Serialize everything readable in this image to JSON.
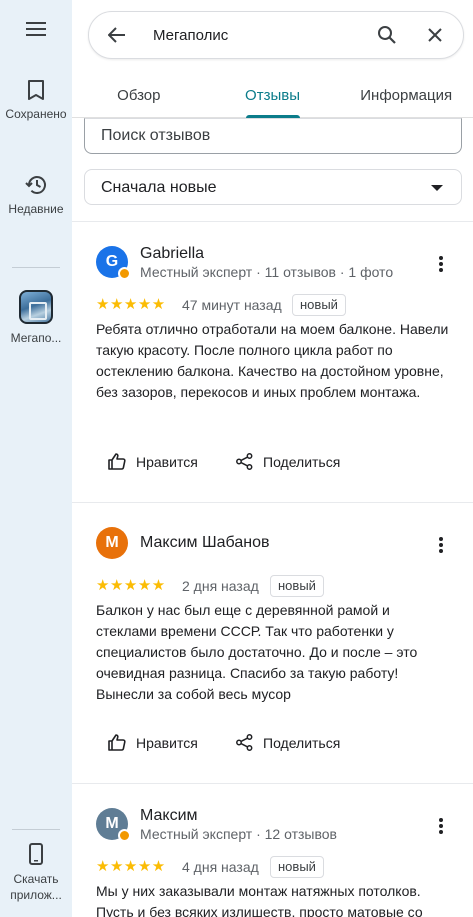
{
  "rail": {
    "menu_icon": "menu-icon",
    "saved_label": "Сохранено",
    "recent_label": "Недавние",
    "place_label": "Мегапо...",
    "download_label": "Скачать прилож..."
  },
  "search": {
    "value": "Мегаполис"
  },
  "tabs": [
    {
      "label": "Обзор",
      "active": false
    },
    {
      "label": "Отзывы",
      "active": true
    },
    {
      "label": "Информация",
      "active": false
    }
  ],
  "filters": {
    "search_placeholder": "Поиск отзывов",
    "sort_value": "Сначала новые"
  },
  "reviews": [
    {
      "initial": "G",
      "avatar_color": "#1a73e8",
      "author": "Gabriella",
      "meta": "Местный эксперт · 11 отзывов · 1 фото",
      "stars": "★★★★★",
      "date": "47 минут назад",
      "badge": "новый",
      "text": "Ребята отлично отработали на моем балконе. Навели такую красоту. После полного цикла работ по остеклению балкона. Качество на достойном уровне, без зазоров, перекосов и иных проблем монтажа.",
      "like_label": "Нравится",
      "share_label": "Поделиться"
    },
    {
      "initial": "М",
      "avatar_color": "#e8710a",
      "author": "Максим Шабанов",
      "meta": "",
      "stars": "★★★★★",
      "date": "2 дня назад",
      "badge": "новый",
      "text": "Балкон у нас был еще с деревянной рамой и стеклами времени СССР. Так что работенки у специалистов было достаточно. До и после – это очевидная разница. Спасибо за такую работу! Вынесли  за собой весь мусор",
      "like_label": "Нравится",
      "share_label": "Поделиться"
    },
    {
      "initial": "М",
      "avatar_color": "#5f7d95",
      "author": "Максим",
      "meta": "Местный эксперт · 12 отзывов",
      "stars": "★★★★★",
      "date": "4 дня назад",
      "badge": "новый",
      "text": "Мы у них заказывали монтаж натяжных потолков. Пусть и без всяких излишеств, просто матовые со"
    }
  ]
}
